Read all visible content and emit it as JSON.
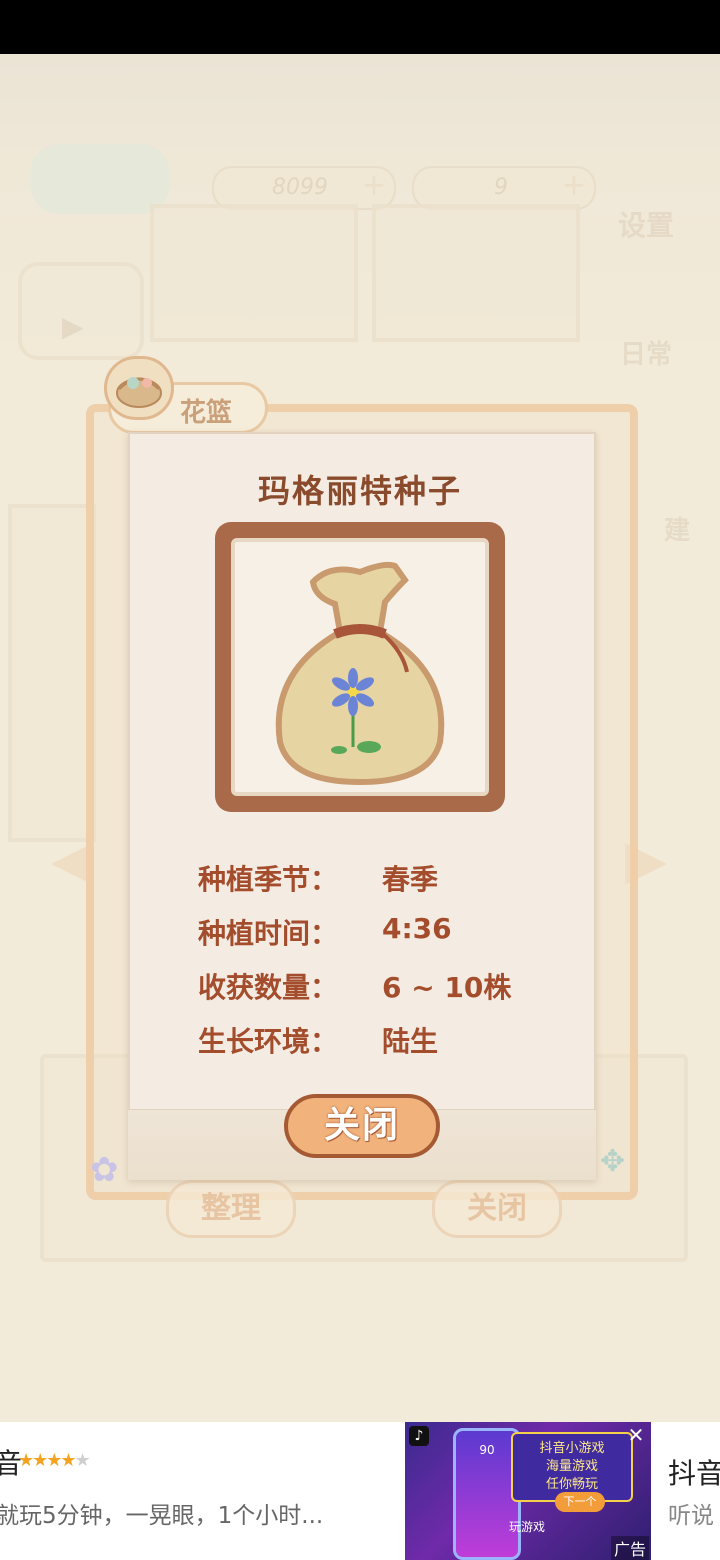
{
  "hud": {
    "fish_count": "8099",
    "ticket_count": "9",
    "settings_label": "设置",
    "daily_label": "日常",
    "build_label": "建"
  },
  "basket": {
    "tab_label": "花篮",
    "bg_sort_button": "整理",
    "bg_close_button": "关闭"
  },
  "seed_card": {
    "title": "玛格丽特种子",
    "rows": [
      {
        "label": "种植季节：",
        "value": "春季"
      },
      {
        "label": "种植时间：",
        "value": "4:36"
      },
      {
        "label": "收获数量：",
        "value": "6 ~ 10株"
      },
      {
        "label": "生长环境：",
        "value": "陆生"
      }
    ],
    "close_button": "关闭"
  },
  "ad": {
    "title": "音",
    "rating": 4,
    "description": "就玩5分钟，一晃眼，1个小时...",
    "image_text_1": "抖音小游戏",
    "image_text_2": "海量游戏",
    "image_text_3": "任你畅玩",
    "image_next": "下一个",
    "image_play": "玩游戏",
    "phone_score": "90",
    "ad_tag": "广告",
    "title_2": "抖音",
    "description_2": "听说"
  },
  "colors": {
    "title_brown": "#8a4a2c",
    "info_red_brown": "#a34d2c",
    "button_orange": "#f1b27c",
    "frame_brown": "#a86a48",
    "star_gold": "#f4a321"
  }
}
